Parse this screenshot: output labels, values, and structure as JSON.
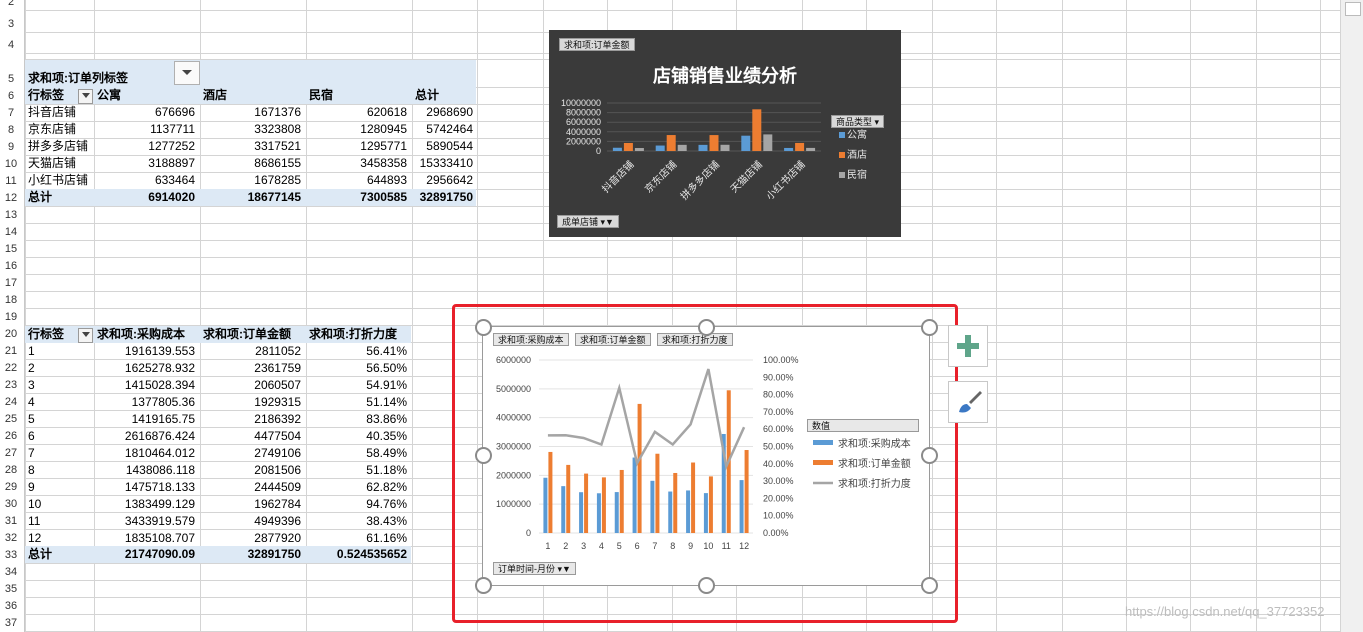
{
  "row_numbers": [
    "2",
    "3",
    "4",
    "5",
    "6",
    "7",
    "8",
    "9",
    "10",
    "11",
    "12",
    "13",
    "14",
    "15",
    "16",
    "17",
    "18",
    "19",
    "20",
    "21",
    "22",
    "23",
    "24",
    "25",
    "26",
    "27",
    "28",
    "29",
    "30",
    "31",
    "32",
    "33",
    "34",
    "35",
    "36",
    "37"
  ],
  "pivot1": {
    "corner_label": "求和项:订单",
    "col_label": "列标签",
    "row_label": "行标签",
    "columns": [
      "公寓",
      "酒店",
      "民宿",
      "总计"
    ],
    "rows": [
      {
        "name": "抖音店铺",
        "v": [
          "676696",
          "1671376",
          "620618",
          "2968690"
        ]
      },
      {
        "name": "京东店铺",
        "v": [
          "1137711",
          "3323808",
          "1280945",
          "5742464"
        ]
      },
      {
        "name": "拼多多店铺",
        "v": [
          "1277252",
          "3317521",
          "1295771",
          "5890544"
        ]
      },
      {
        "name": "天猫店铺",
        "v": [
          "3188897",
          "8686155",
          "3458358",
          "15333410"
        ]
      },
      {
        "name": "小红书店铺",
        "v": [
          "633464",
          "1678285",
          "644893",
          "2956642"
        ]
      }
    ],
    "total": {
      "name": "总计",
      "v": [
        "6914020",
        "18677145",
        "7300585",
        "32891750"
      ]
    }
  },
  "pivot2": {
    "row_label": "行标签",
    "columns": [
      "求和项:采购成本",
      "求和项:订单金额",
      "求和项:打折力度"
    ],
    "rows": [
      {
        "name": "1",
        "v": [
          "1916139.553",
          "2811052",
          "56.41%"
        ]
      },
      {
        "name": "2",
        "v": [
          "1625278.932",
          "2361759",
          "56.50%"
        ]
      },
      {
        "name": "3",
        "v": [
          "1415028.394",
          "2060507",
          "54.91%"
        ]
      },
      {
        "name": "4",
        "v": [
          "1377805.36",
          "1929315",
          "51.14%"
        ]
      },
      {
        "name": "5",
        "v": [
          "1419165.75",
          "2186392",
          "83.86%"
        ]
      },
      {
        "name": "6",
        "v": [
          "2616876.424",
          "4477504",
          "40.35%"
        ]
      },
      {
        "name": "7",
        "v": [
          "1810464.012",
          "2749106",
          "58.49%"
        ]
      },
      {
        "name": "8",
        "v": [
          "1438086.118",
          "2081506",
          "51.18%"
        ]
      },
      {
        "name": "9",
        "v": [
          "1475718.133",
          "2444509",
          "62.82%"
        ]
      },
      {
        "name": "10",
        "v": [
          "1383499.129",
          "1962784",
          "94.76%"
        ]
      },
      {
        "name": "11",
        "v": [
          "3433919.579",
          "4949396",
          "38.43%"
        ]
      },
      {
        "name": "12",
        "v": [
          "1835108.707",
          "2877920",
          "61.16%"
        ]
      }
    ],
    "total": {
      "name": "总计",
      "v": [
        "21747090.09",
        "32891750",
        "0.524535652"
      ]
    }
  },
  "chart_data": [
    {
      "type": "bar",
      "title": "店铺销售业绩分析",
      "value_chip": "求和项:订单金额",
      "axis_chip": "成单店铺",
      "legend_title": "商品类型",
      "categories": [
        "抖音店铺",
        "京东店铺",
        "拼多多店铺",
        "天猫店铺",
        "小红书店铺"
      ],
      "series": [
        {
          "name": "公寓",
          "color": "#5b9bd5",
          "values": [
            676696,
            1137711,
            1277252,
            3188897,
            633464
          ]
        },
        {
          "name": "酒店",
          "color": "#ed7d31",
          "values": [
            1671376,
            3323808,
            3317521,
            8686155,
            1678285
          ]
        },
        {
          "name": "民宿",
          "color": "#a5a5a5",
          "values": [
            620618,
            1280945,
            1295771,
            3458358,
            644893
          ]
        }
      ],
      "ylim": [
        0,
        10000000
      ],
      "yticks": [
        "10000000",
        "8000000",
        "6000000",
        "4000000",
        "2000000",
        "0"
      ],
      "legend_position": "right"
    },
    {
      "type": "bar",
      "value_chips": [
        "求和项:采购成本",
        "求和项:订单金额",
        "求和项:打折力度"
      ],
      "axis_chip": "订单时间-月份",
      "legend_title": "数值",
      "categories": [
        "1",
        "2",
        "3",
        "4",
        "5",
        "6",
        "7",
        "8",
        "9",
        "10",
        "11",
        "12"
      ],
      "series": [
        {
          "name": "求和项:采购成本",
          "type": "bar",
          "color": "#5b9bd5",
          "values": [
            1916139.553,
            1625278.932,
            1415028.394,
            1377805.36,
            1419165.75,
            2616876.424,
            1810464.012,
            1438086.118,
            1475718.133,
            1383499.129,
            3433919.579,
            1835108.707
          ]
        },
        {
          "name": "求和项:订单金额",
          "type": "bar",
          "color": "#ed7d31",
          "values": [
            2811052,
            2361759,
            2060507,
            1929315,
            2186392,
            4477504,
            2749106,
            2081506,
            2444509,
            1962784,
            4949396,
            2877920
          ]
        },
        {
          "name": "求和项:打折力度",
          "type": "line",
          "axis": "secondary",
          "color": "#a5a5a5",
          "values": [
            0.5641,
            0.565,
            0.5491,
            0.5114,
            0.8386,
            0.4035,
            0.5849,
            0.5118,
            0.6282,
            0.9476,
            0.3843,
            0.6116
          ]
        }
      ],
      "ylim": [
        0,
        6000000
      ],
      "yticks": [
        "6000000",
        "5000000",
        "4000000",
        "3000000",
        "2000000",
        "1000000",
        "0"
      ],
      "y2lim": [
        0,
        1
      ],
      "y2ticks": [
        "100.00%",
        "90.00%",
        "80.00%",
        "70.00%",
        "60.00%",
        "50.00%",
        "40.00%",
        "30.00%",
        "20.00%",
        "10.00%",
        "0.00%"
      ],
      "legend_position": "right"
    }
  ],
  "watermark": "https://blog.csdn.net/qq_37723352"
}
